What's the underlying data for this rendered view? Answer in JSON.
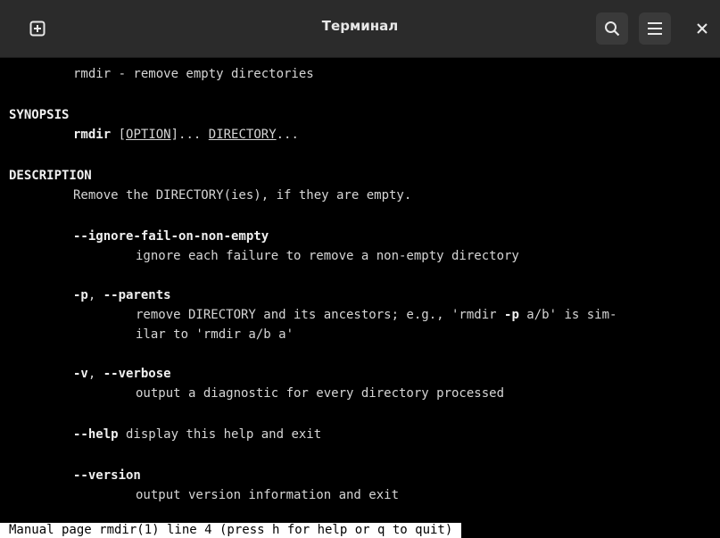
{
  "window": {
    "title": "Терминал"
  },
  "man": {
    "name_line": "rmdir - remove empty directories",
    "synopsis_heading": "SYNOPSIS",
    "synopsis_cmd": "rmdir",
    "synopsis_sp1": " ",
    "synopsis_opt_open": "[",
    "synopsis_opt": "OPTION",
    "synopsis_opt_close": "]... ",
    "synopsis_dir": "DIRECTORY",
    "synopsis_dir_tail": "...",
    "description_heading": "DESCRIPTION",
    "description_text": "Remove the DIRECTORY(ies), if they are empty.",
    "opt1_flag": "--ignore-fail-on-non-empty",
    "opt1_desc": "ignore each failure to remove a non-empty directory",
    "opt2_short": "-p",
    "opt2_sep": ", ",
    "opt2_long": "--parents",
    "opt2_desc1_a": "remove DIRECTORY and its ancestors; e.g., 'rmdir ",
    "opt2_desc1_flag": "-p",
    "opt2_desc1_b": " a/b' is sim-",
    "opt2_desc2": "ilar to 'rmdir a/b a'",
    "opt3_short": "-v",
    "opt3_sep": ", ",
    "opt3_long": "--verbose",
    "opt3_desc": "output a diagnostic for every directory processed",
    "opt4_flag": "--help",
    "opt4_desc": " display this help and exit",
    "opt5_flag": "--version",
    "opt5_desc": "output version information and exit"
  },
  "status_line": "Manual page rmdir(1) line 4 (press h for help or q to quit)"
}
